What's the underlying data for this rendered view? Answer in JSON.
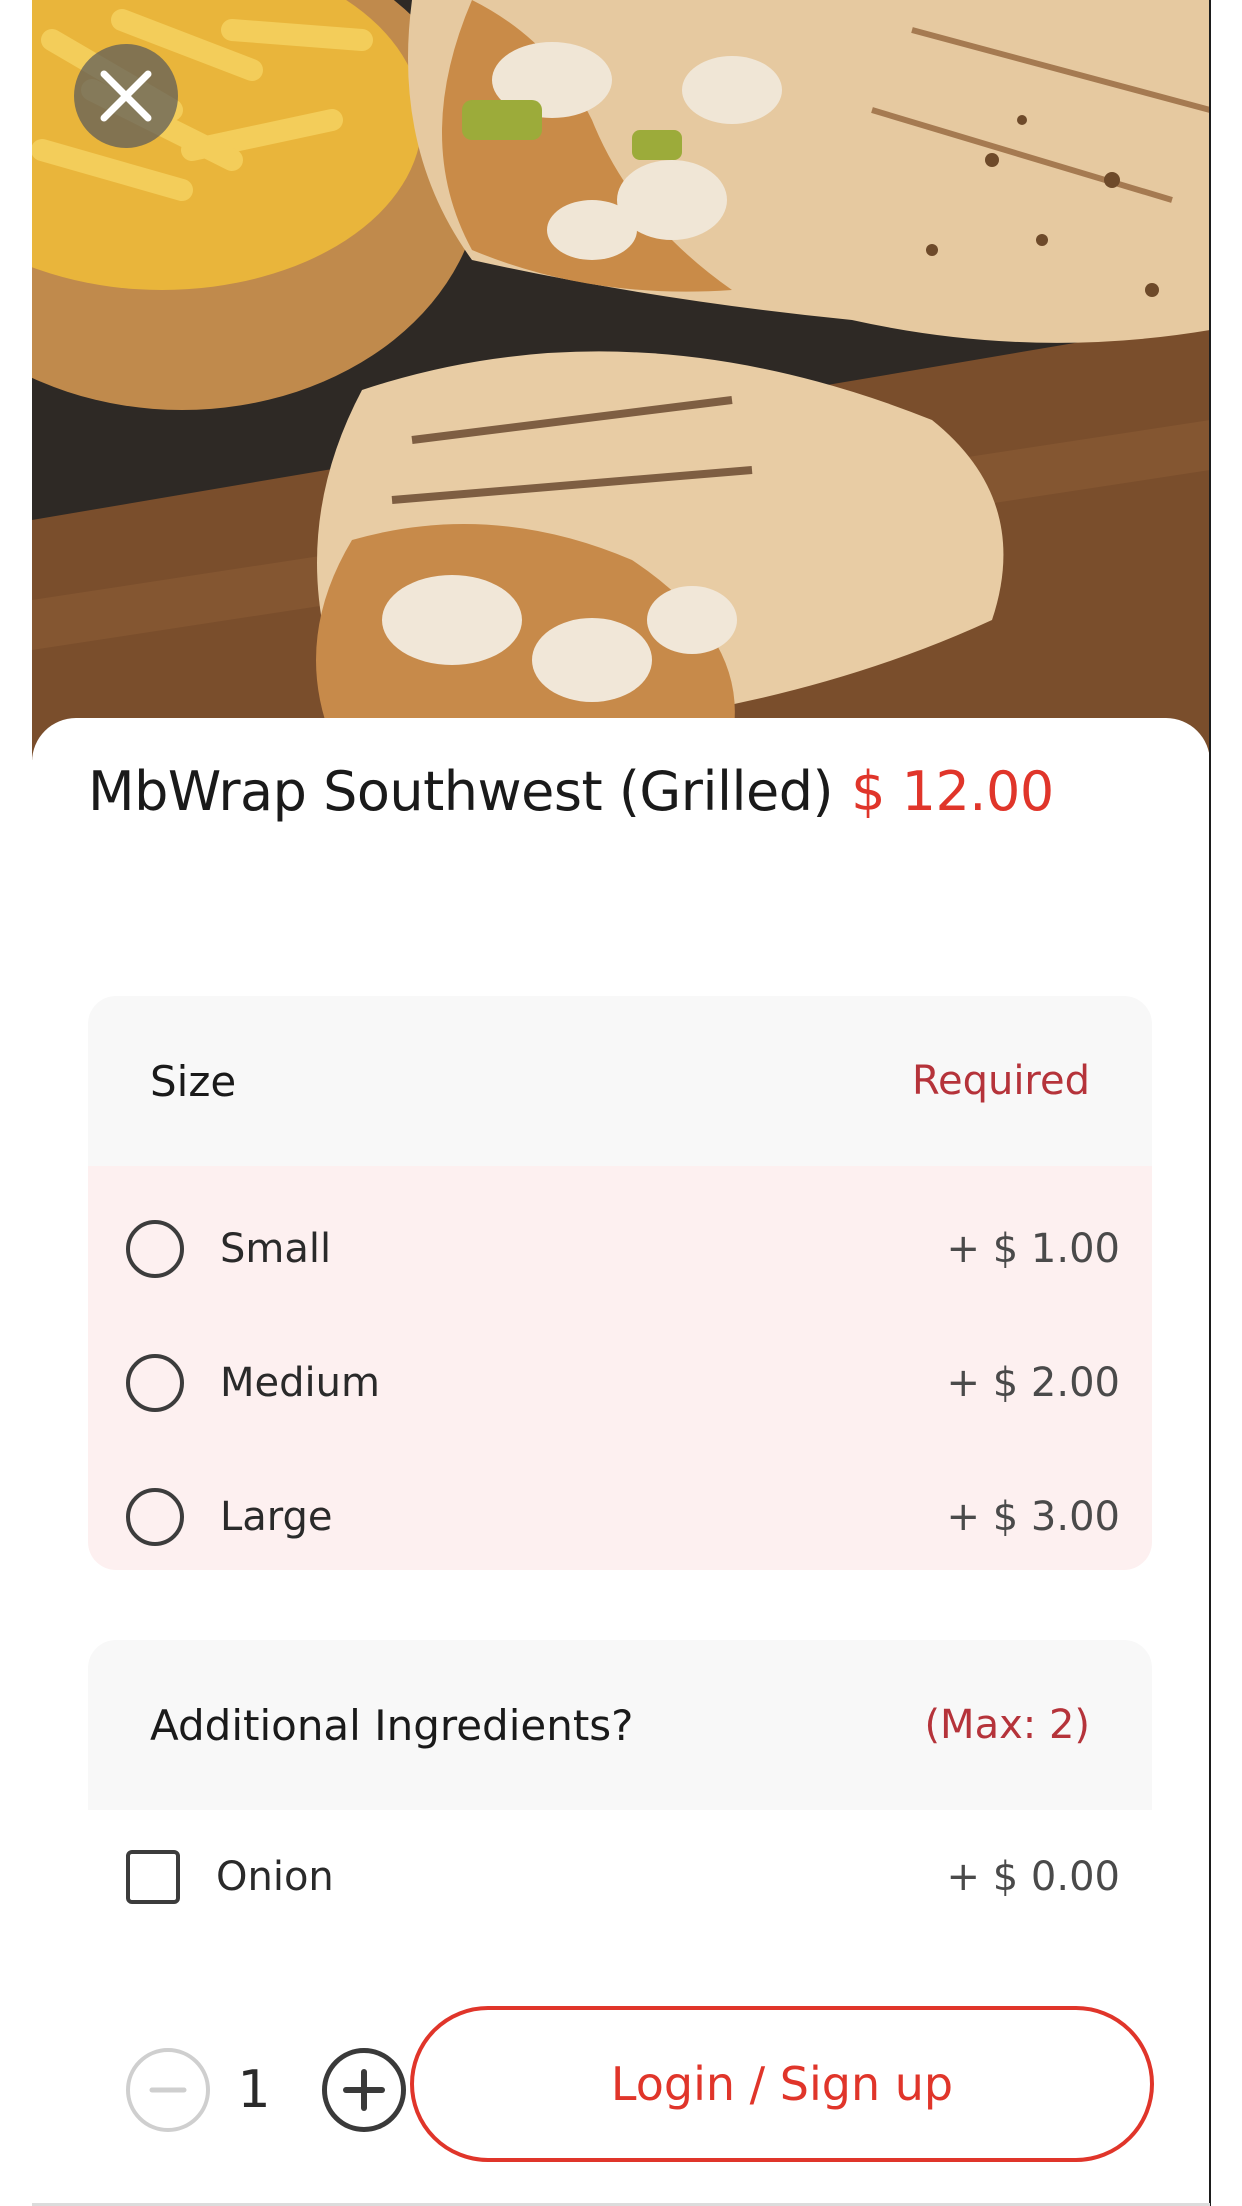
{
  "item": {
    "name": "MbWrap Southwest (Grilled)",
    "price": "$ 12.00"
  },
  "size_section": {
    "title": "Size",
    "requirement": "Required",
    "options": [
      {
        "label": "Small",
        "price": "+ $ 1.00"
      },
      {
        "label": "Medium",
        "price": "+ $ 2.00"
      },
      {
        "label": "Large",
        "price": "+ $ 3.00"
      }
    ]
  },
  "ingredients_section": {
    "title": "Additional Ingredients?",
    "requirement": "(Max: 2)",
    "options": [
      {
        "label": "Onion",
        "price": "+ $ 0.00"
      }
    ]
  },
  "quantity": {
    "value": "1"
  },
  "cta": {
    "label": "Login / Sign up"
  },
  "icons": {
    "close": "close-icon",
    "minus": "minus-circle-icon",
    "plus": "plus-circle-icon"
  },
  "colors": {
    "accent": "#e0352a",
    "required_text": "#b5333a",
    "options_background": "#fdf0f0"
  }
}
